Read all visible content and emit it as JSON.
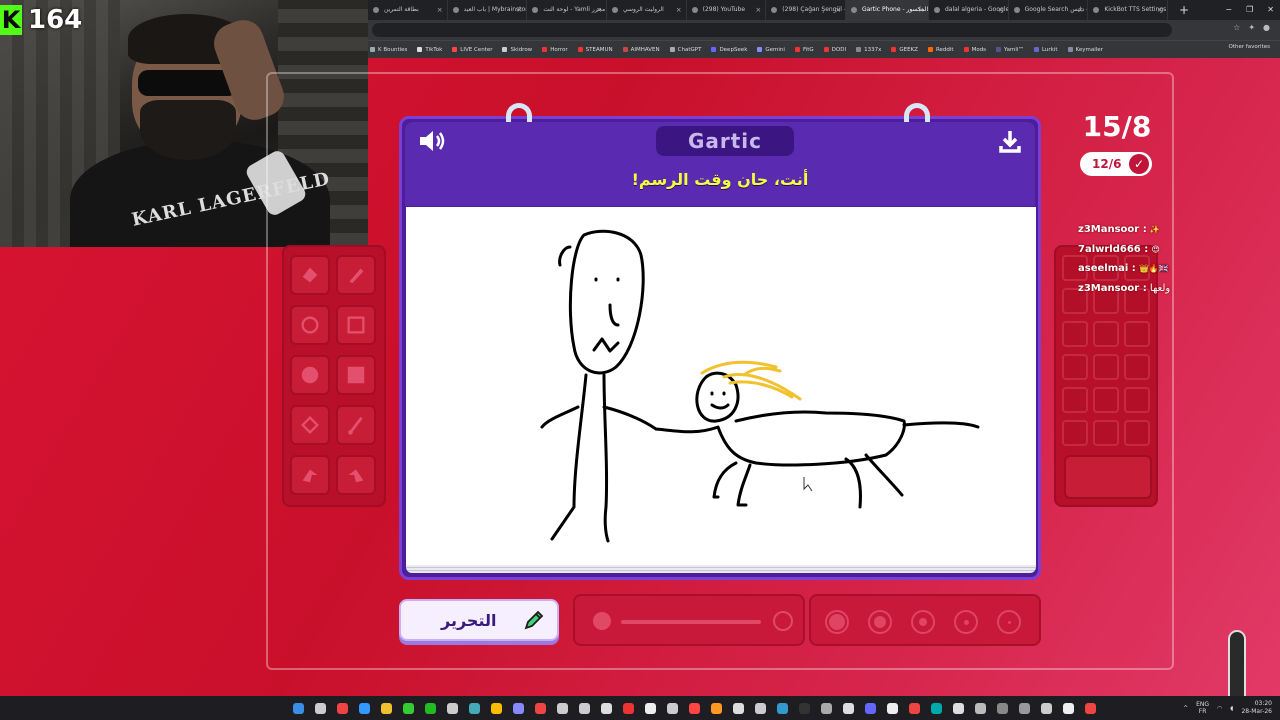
{
  "browser": {
    "tabs": [
      {
        "label": "بطاقة التمرين"
      },
      {
        "label": "باب العيد | Mybrainstorm"
      },
      {
        "label": "لوحة النت - Yamli محرر"
      },
      {
        "label": "الروليت الروسي"
      },
      {
        "label": "(298) YouTube"
      },
      {
        "label": "(298) Çağan Şengül - ..."
      },
      {
        "label": "Gartic Phone - المكسور",
        "active": true
      },
      {
        "label": "dalal algeria - Google ..."
      },
      {
        "label": "Google Search دليس - ..."
      },
      {
        "label": "KickBot TTS Settings"
      }
    ],
    "new_tab": "+",
    "window_controls": [
      "−",
      "❐",
      "✕"
    ],
    "bookmarks": [
      "K Bounties",
      "TikTok",
      "LIVE Center",
      "Skidrow",
      "Horror",
      "STEAMUN",
      "AIMHAVEN",
      "ChatGPT",
      "DeepSeek",
      "Gemini",
      "FitG",
      "DODI",
      "1337x",
      "GEEKZ",
      "Reddit",
      "Mods",
      "Yamli™",
      "Lurkit",
      "Keymailer"
    ],
    "other_favorites": "Other favorites"
  },
  "stream": {
    "viewer_count": "164",
    "shirt_text": "KARL LAGERFELD"
  },
  "game": {
    "logo": "Gartic",
    "prompt": "أنت، حان وقت الرسم!",
    "round": "15/8",
    "done": "12/6",
    "edit_button": "التحرير"
  },
  "chat": [
    {
      "user": "z3Mansoor :",
      "text": "",
      "emoji": "✨"
    },
    {
      "user": "7alwrld666 :",
      "text": "",
      "emoji": "😍"
    },
    {
      "user": "aseelmai :",
      "text": "",
      "emoji": "👑🔥🇬🇧"
    },
    {
      "user": "z3Mansoor :",
      "text": "ولعها",
      "emoji": ""
    }
  ],
  "colors": {
    "accent": "#c0143a",
    "book": "#4b1f9a",
    "prompt": "#f2ff3c"
  },
  "taskbar": {
    "lang": "ENG",
    "lang2": "FR",
    "time": "03:20",
    "date": "28-Mar-26"
  }
}
